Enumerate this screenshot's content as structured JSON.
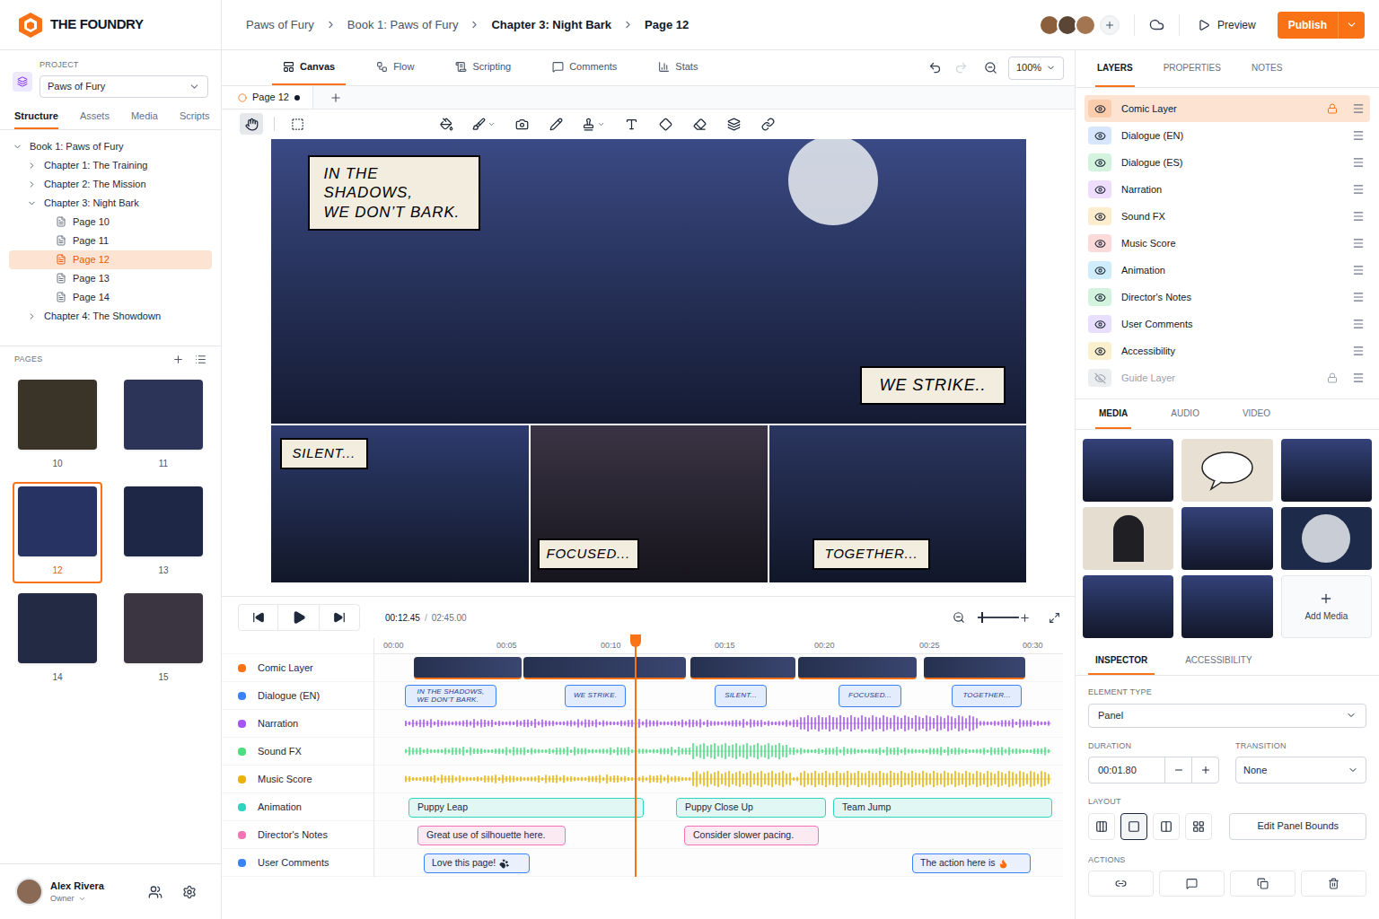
{
  "app": {
    "name": "THE FOUNDRY"
  },
  "project": {
    "label": "PROJECT",
    "value": "Paws of Fury"
  },
  "sidebar_tabs": [
    {
      "label": "Structure",
      "selected": true
    },
    {
      "label": "Assets",
      "selected": false
    },
    {
      "label": "Media",
      "selected": false
    },
    {
      "label": "Scripts",
      "selected": false
    }
  ],
  "tree": [
    {
      "label": "Book 1: Paws of Fury",
      "depth": 0,
      "kind": "folder",
      "expanded": true,
      "selected": false
    },
    {
      "label": "Chapter 1: The Training",
      "depth": 1,
      "kind": "folder",
      "expanded": false,
      "selected": false
    },
    {
      "label": "Chapter 2: The Mission",
      "depth": 1,
      "kind": "folder",
      "expanded": false,
      "selected": false
    },
    {
      "label": "Chapter 3: Night Bark",
      "depth": 1,
      "kind": "folder",
      "expanded": true,
      "selected": false
    },
    {
      "label": "Page 10",
      "depth": 2,
      "kind": "page",
      "expanded": false,
      "selected": false
    },
    {
      "label": "Page 11",
      "depth": 2,
      "kind": "page",
      "expanded": false,
      "selected": false
    },
    {
      "label": "Page 12",
      "depth": 2,
      "kind": "page",
      "expanded": false,
      "selected": true
    },
    {
      "label": "Page 13",
      "depth": 2,
      "kind": "page",
      "expanded": false,
      "selected": false
    },
    {
      "label": "Page 14",
      "depth": 2,
      "kind": "page",
      "expanded": false,
      "selected": false
    },
    {
      "label": "Chapter 4: The Showdown",
      "depth": 1,
      "kind": "folder",
      "expanded": false,
      "selected": false
    }
  ],
  "pages_panel": {
    "title": "PAGES",
    "pages": [
      {
        "label": "10",
        "selected": false
      },
      {
        "label": "11",
        "selected": false
      },
      {
        "label": "12",
        "selected": true
      },
      {
        "label": "13",
        "selected": false
      },
      {
        "label": "14",
        "selected": false
      },
      {
        "label": "15",
        "selected": false
      }
    ]
  },
  "user": {
    "name": "Alex Rivera",
    "role": "Owner"
  },
  "breadcrumbs": [
    "Paws of Fury",
    "Book 1: Paws of Fury",
    "Chapter 3: Night Bark",
    "Page 12"
  ],
  "collaborators": [
    {
      "color": "#8b5e3c"
    },
    {
      "color": "#5b4636"
    },
    {
      "color": "#a47551"
    }
  ],
  "preview": "Preview",
  "publish": "Publish",
  "view_tabs": [
    {
      "label": "Canvas",
      "selected": true
    },
    {
      "label": "Flow",
      "selected": false
    },
    {
      "label": "Scripting",
      "selected": false
    },
    {
      "label": "Comments",
      "selected": false
    },
    {
      "label": "Stats",
      "selected": false
    }
  ],
  "undo_enabled": true,
  "redo_enabled": false,
  "zoom": "100%",
  "doc_tabs": [
    {
      "label": "Page 12",
      "unsaved": true,
      "selected": true
    }
  ],
  "tools": [
    {
      "selected": true,
      "menu": false
    },
    {
      "selected": false,
      "menu": false
    },
    {
      "selected": false,
      "menu": false
    },
    {
      "selected": false,
      "menu": true
    },
    {
      "selected": false,
      "menu": false
    },
    {
      "selected": false,
      "menu": false
    },
    {
      "selected": false,
      "menu": true
    },
    {
      "selected": false,
      "menu": false
    },
    {
      "selected": false,
      "menu": false
    },
    {
      "selected": false,
      "menu": false
    },
    {
      "selected": false,
      "menu": false
    },
    {
      "selected": false,
      "menu": false
    }
  ],
  "comic": {
    "panels": [
      {
        "captions": [
          "IN THE SHADOWS,\nWE DON’T BARK.",
          "WE STRIKE.."
        ]
      },
      {
        "captions": [
          "SILENT..."
        ]
      },
      {
        "captions": [
          "FOCUSED..."
        ]
      },
      {
        "captions": [
          "TOGETHER..."
        ]
      }
    ]
  },
  "playback": {
    "playing": false,
    "current": "00:12.45",
    "separator": "/",
    "total": "02:45.00",
    "zoom_level": 0.08
  },
  "timeline": {
    "ticks": [
      "00:00",
      "00:05",
      "00:10",
      "00:15",
      "00:20",
      "00:25",
      "00:30"
    ],
    "playhead_level": 0.378,
    "tracks": [
      {
        "name": "Comic Layer",
        "color": "#f97316",
        "kind": "thumbnails",
        "clips": [
          {},
          {},
          {},
          {},
          {}
        ]
      },
      {
        "name": "Dialogue (EN)",
        "color": "#3b82f6",
        "kind": "captions",
        "clips": [
          {
            "text": "IN THE SHADOWS,\nWE DON’T BARK."
          },
          {
            "text": "WE STRIKE."
          },
          {
            "text": "SILENT..."
          },
          {
            "text": "FOCUSED..."
          },
          {
            "text": "TOGETHER..."
          }
        ]
      },
      {
        "name": "Narration",
        "color": "#a855f7",
        "kind": "wave",
        "clips": []
      },
      {
        "name": "Sound FX",
        "color": "#4ade80",
        "kind": "wave",
        "clips": []
      },
      {
        "name": "Music Score",
        "color": "#eab308",
        "kind": "wave",
        "clips": []
      },
      {
        "name": "Animation",
        "color": "#2dd4bf",
        "kind": "blocks",
        "clips": [
          {
            "text": "Puppy Leap"
          },
          {
            "text": "Puppy Close Up"
          },
          {
            "text": "Team Jump"
          }
        ]
      },
      {
        "name": "Director's Notes",
        "color": "#f472b6",
        "kind": "notes",
        "clips": [
          {
            "text": "Great use of silhouette here."
          },
          {
            "text": "Consider slower pacing."
          }
        ]
      },
      {
        "name": "User Comments",
        "color": "#3b82f6",
        "kind": "comments",
        "clips": [
          {
            "text": "Love this page!"
          },
          {
            "text": "The action here is"
          }
        ]
      }
    ]
  },
  "right_tabs": [
    {
      "label": "LAYERS",
      "selected": true
    },
    {
      "label": "PROPERTIES",
      "selected": false
    },
    {
      "label": "NOTES",
      "selected": false
    }
  ],
  "layers": [
    {
      "name": "Comic Layer",
      "color": "#f97316",
      "visible": true,
      "locked": true,
      "selected": true
    },
    {
      "name": "Dialogue (EN)",
      "color": "#3b82f6",
      "visible": true,
      "locked": false,
      "selected": false
    },
    {
      "name": "Dialogue (ES)",
      "color": "#22c55e",
      "visible": true,
      "locked": false,
      "selected": false
    },
    {
      "name": "Narration",
      "color": "#a855f7",
      "visible": true,
      "locked": false,
      "selected": false
    },
    {
      "name": "Sound FX",
      "color": "#f59e0b",
      "visible": true,
      "locked": false,
      "selected": false
    },
    {
      "name": "Music Score",
      "color": "#ef4444",
      "visible": true,
      "locked": false,
      "selected": false
    },
    {
      "name": "Animation",
      "color": "#0ea5e9",
      "visible": true,
      "locked": false,
      "selected": false
    },
    {
      "name": "Director's Notes",
      "color": "#22c55e",
      "visible": true,
      "locked": false,
      "selected": false
    },
    {
      "name": "User Comments",
      "color": "#8b5cf6",
      "visible": true,
      "locked": false,
      "selected": false
    },
    {
      "name": "Accessibility",
      "color": "#eab308",
      "visible": true,
      "locked": false,
      "selected": false
    },
    {
      "name": "Guide Layer",
      "color": "#9ca3af",
      "visible": false,
      "locked": true,
      "selected": false
    }
  ],
  "media_tabs": [
    {
      "label": "MEDIA",
      "selected": true
    },
    {
      "label": "AUDIO",
      "selected": false
    },
    {
      "label": "VIDEO",
      "selected": false
    }
  ],
  "media": {
    "items": [
      {
        "kind": "scene"
      },
      {
        "kind": "bubble"
      },
      {
        "kind": "scene"
      },
      {
        "kind": "character"
      },
      {
        "kind": "scene"
      },
      {
        "kind": "moon"
      },
      {
        "kind": "scene"
      },
      {
        "kind": "scene"
      }
    ],
    "add_label": "Add Media"
  },
  "inspector_tabs": [
    {
      "label": "INSPECTOR",
      "selected": true
    },
    {
      "label": "ACCESSIBILITY",
      "selected": false
    }
  ],
  "inspector": {
    "element_type": {
      "label": "ELEMENT TYPE",
      "value": "Panel"
    },
    "duration": {
      "label": "DURATION",
      "value": "00:01.80"
    },
    "transition": {
      "label": "TRANSITION",
      "value": "None"
    },
    "layout": {
      "label": "LAYOUT",
      "options": [
        {
          "selected": false
        },
        {
          "selected": true
        },
        {
          "selected": false
        },
        {
          "selected": false
        }
      ],
      "edit_button": "Edit Panel Bounds"
    },
    "actions": {
      "label": "ACTIONS"
    }
  }
}
